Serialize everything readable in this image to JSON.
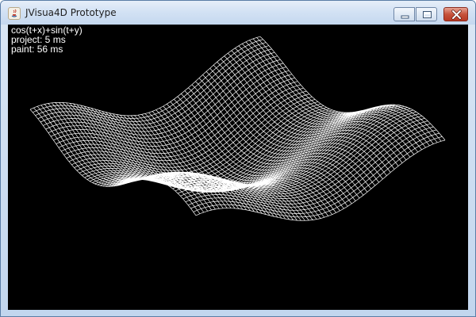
{
  "window": {
    "title": "JVisua4D Prototype",
    "buttons": {
      "minimize": "minimize",
      "maximize": "maximize",
      "close": "close"
    }
  },
  "viewport": {
    "function": "cos(t+x)+sin(t+y)",
    "project_time": "project: 5 ms",
    "paint_time": "paint: 56 ms",
    "background_color": "#000000",
    "mesh_color": "#ffffff"
  }
}
